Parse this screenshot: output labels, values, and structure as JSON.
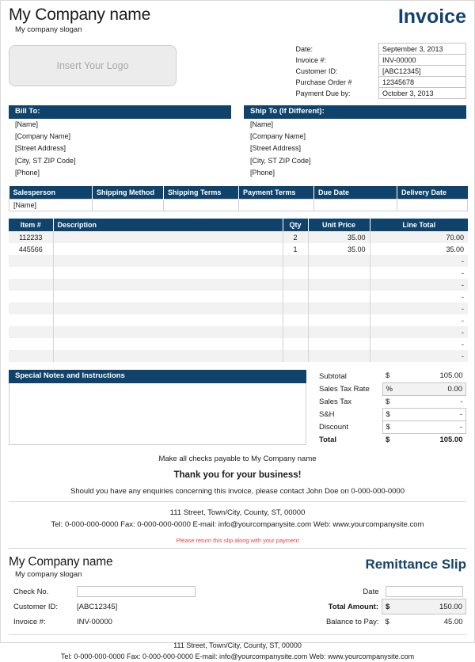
{
  "company": {
    "name": "My Company name",
    "slogan": "My company slogan",
    "logo_placeholder": "Insert Your Logo"
  },
  "document": {
    "title": "Invoice"
  },
  "meta": {
    "rows": [
      {
        "label": "Date:",
        "value": "September 3, 2013"
      },
      {
        "label": "Invoice #:",
        "value": "INV-00000"
      },
      {
        "label": "Customer ID:",
        "value": "[ABC12345]"
      },
      {
        "label": "Purchase Order #",
        "value": "12345678"
      },
      {
        "label": "Payment Due by:",
        "value": "October 3, 2013"
      }
    ]
  },
  "bill_to": {
    "heading": "Bill To:",
    "lines": [
      "[Name]",
      "[Company Name]",
      "[Street Address]",
      "[City, ST  ZIP Code]",
      "[Phone]"
    ]
  },
  "ship_to": {
    "heading": "Ship To (If Different):",
    "lines": [
      "[Name]",
      "[Company Name]",
      "[Street Address]",
      "[City, ST  ZIP Code]",
      "[Phone]"
    ]
  },
  "terms": {
    "headers": [
      "Salesperson",
      "Shipping Method",
      "Shipping Terms",
      "Payment Terms",
      "Due Date",
      "Delivery Date"
    ],
    "values": [
      "[Name]",
      "",
      "",
      "",
      "",
      ""
    ]
  },
  "items": {
    "headers": {
      "item": "Item #",
      "description": "Description",
      "qty": "Qty",
      "unit_price": "Unit Price",
      "line_total": "Line Total"
    },
    "rows": [
      {
        "item": "112233",
        "description": "",
        "qty": "2",
        "unit_price": "35.00",
        "line_total": "70.00"
      },
      {
        "item": "445566",
        "description": "",
        "qty": "1",
        "unit_price": "35.00",
        "line_total": "35.00"
      },
      {
        "item": "",
        "description": "",
        "qty": "",
        "unit_price": "",
        "line_total": "-"
      },
      {
        "item": "",
        "description": "",
        "qty": "",
        "unit_price": "",
        "line_total": "-"
      },
      {
        "item": "",
        "description": "",
        "qty": "",
        "unit_price": "",
        "line_total": "-"
      },
      {
        "item": "",
        "description": "",
        "qty": "",
        "unit_price": "",
        "line_total": "-"
      },
      {
        "item": "",
        "description": "",
        "qty": "",
        "unit_price": "",
        "line_total": "-"
      },
      {
        "item": "",
        "description": "",
        "qty": "",
        "unit_price": "",
        "line_total": "-"
      },
      {
        "item": "",
        "description": "",
        "qty": "",
        "unit_price": "",
        "line_total": "-"
      },
      {
        "item": "",
        "description": "",
        "qty": "",
        "unit_price": "",
        "line_total": "-"
      },
      {
        "item": "",
        "description": "",
        "qty": "",
        "unit_price": "",
        "line_total": "-"
      }
    ]
  },
  "notes": {
    "heading": "Special Notes and Instructions",
    "body": ""
  },
  "totals": {
    "subtotal": {
      "label": "Subtotal",
      "symbol": "$",
      "amount": "105.00"
    },
    "sales_tax_rate": {
      "label": "Sales Tax Rate",
      "symbol": "%",
      "amount": "0.00"
    },
    "sales_tax": {
      "label": "Sales Tax",
      "symbol": "$",
      "amount": "-"
    },
    "shipping": {
      "label": "S&H",
      "symbol": "$",
      "amount": "-"
    },
    "discount": {
      "label": "Discount",
      "symbol": "$",
      "amount": "-"
    },
    "total": {
      "label": "Total",
      "symbol": "$",
      "amount": "105.00"
    }
  },
  "footer": {
    "payable": "Make all checks payable to My Company name",
    "thanks": "Thank you for your business!",
    "enquiries": "Should you have any enquiries concerning this invoice, please contact John Doe on 0-000-000-0000",
    "address": "111 Street, Town/City, County, ST, 00000",
    "contact": "Tel: 0-000-000-0000 Fax: 0-000-000-0000 E-mail: info@yourcompanysite.com Web: www.yourcompanysite.com",
    "slip_notice": "Please return this slip along with your payment"
  },
  "remittance": {
    "title": "Remittance Slip",
    "company_name": "My Company name",
    "slogan": "My company slogan",
    "check_no_label": "Check No.",
    "check_no_value": "",
    "customer_id_label": "Customer ID:",
    "customer_id_value": "[ABC12345]",
    "invoice_no_label": "Invoice #:",
    "invoice_no_value": "INV-00000",
    "date_label": "Date",
    "date_value": "",
    "total_amount_label": "Total Amount:",
    "total_amount_symbol": "$",
    "total_amount_value": "150.00",
    "balance_label": "Balance to Pay:",
    "balance_symbol": "$",
    "balance_value": "45.00",
    "address": "111 Street, Town/City, County, ST, 00000",
    "contact": "Tel: 0-000-000-0000 Fax: 0-000-000-0000 E-mail: info@yourcompanysite.com Web: www.yourcompanysite.com"
  },
  "colors": {
    "navy": "#0f436b",
    "accent_blue": "#12436c",
    "alt_row": "#f2f2f2",
    "notice_red": "#e8413a"
  }
}
